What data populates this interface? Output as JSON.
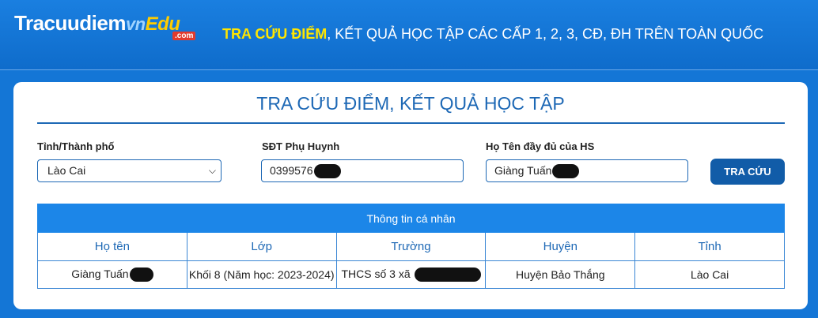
{
  "header": {
    "logo": {
      "part1": "Tracuudiem",
      "part2": "vn",
      "part3": "Edu",
      "sub": ".com"
    },
    "tagline_highlight": "TRA CỨU ĐIỂM",
    "tagline_rest": ", KẾT QUẢ HỌC TẬP CÁC CẤP 1, 2, 3, CĐ, ĐH TRÊN TOÀN QUỐC"
  },
  "form": {
    "title": "TRA CỨU ĐIỂM, KẾT QUẢ HỌC TẬP",
    "province_label": "Tỉnh/Thành phố",
    "province_value": "Lào Cai",
    "phone_label": "SĐT Phụ Huynh",
    "phone_value": "0399576",
    "name_label": "Họ Tên đầy đủ của HS",
    "name_value": "Giàng Tuấn",
    "submit_label": "TRA CỨU"
  },
  "result": {
    "caption": "Thông tin cá nhân",
    "columns": [
      "Họ tên",
      "Lớp",
      "Trường",
      "Huyện",
      "Tỉnh"
    ],
    "row": {
      "name": "Giàng Tuấn",
      "class": "Khối 8 (Năm học: 2023-2024)",
      "school": "THCS số 3 xã",
      "district": "Huyện Bảo Thắng",
      "province": "Lào Cai"
    }
  },
  "colors": {
    "accent": "#1d68b5",
    "header_bg": "#1476d6",
    "table_header": "#1c86e8",
    "highlight": "#ffe600"
  }
}
